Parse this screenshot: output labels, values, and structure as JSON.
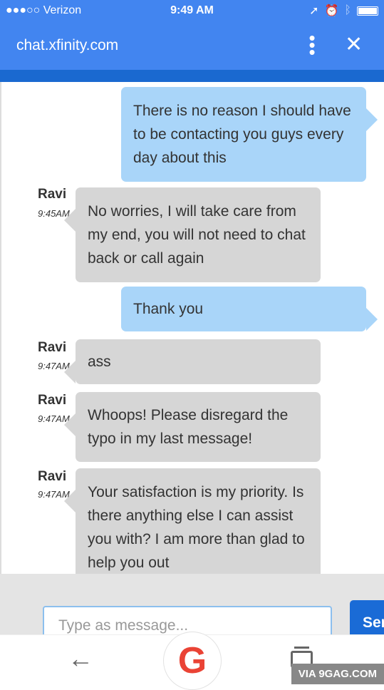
{
  "status_bar": {
    "carrier": "●●●○○ Verizon",
    "time": "9:49 AM"
  },
  "header": {
    "title": "chat.xfinity.com",
    "menu_icon": "more-vert-icon",
    "close_icon": "close-icon"
  },
  "messages": [
    {
      "from": "user",
      "text": "There is no reason I should have to be contacting you guys every day about this"
    },
    {
      "from": "agent",
      "name": "Ravi",
      "time": "9:45AM",
      "text": "No worries, I will take care from my end, you will not need to chat back or call again"
    },
    {
      "from": "user",
      "text": "Thank you"
    },
    {
      "from": "agent",
      "name": "Ravi",
      "time": "9:47AM",
      "text": "ass"
    },
    {
      "from": "agent",
      "name": "Ravi",
      "time": "9:47AM",
      "text": "Whoops! Please disregard the typo in my last message!"
    },
    {
      "from": "agent",
      "name": "Ravi",
      "time": "9:47AM",
      "text": "Your satisfaction is my priority. Is there anything else I can assist you with? I am more than glad to help you out"
    }
  ],
  "composer": {
    "placeholder": "Type as message...",
    "send_label": "Send"
  },
  "watermark": "VIA 9GAG.COM",
  "colors": {
    "header": "#4285f0",
    "user_bubble": "#a9d5f9",
    "agent_bubble": "#d6d6d6",
    "send": "#1a6bd6"
  }
}
